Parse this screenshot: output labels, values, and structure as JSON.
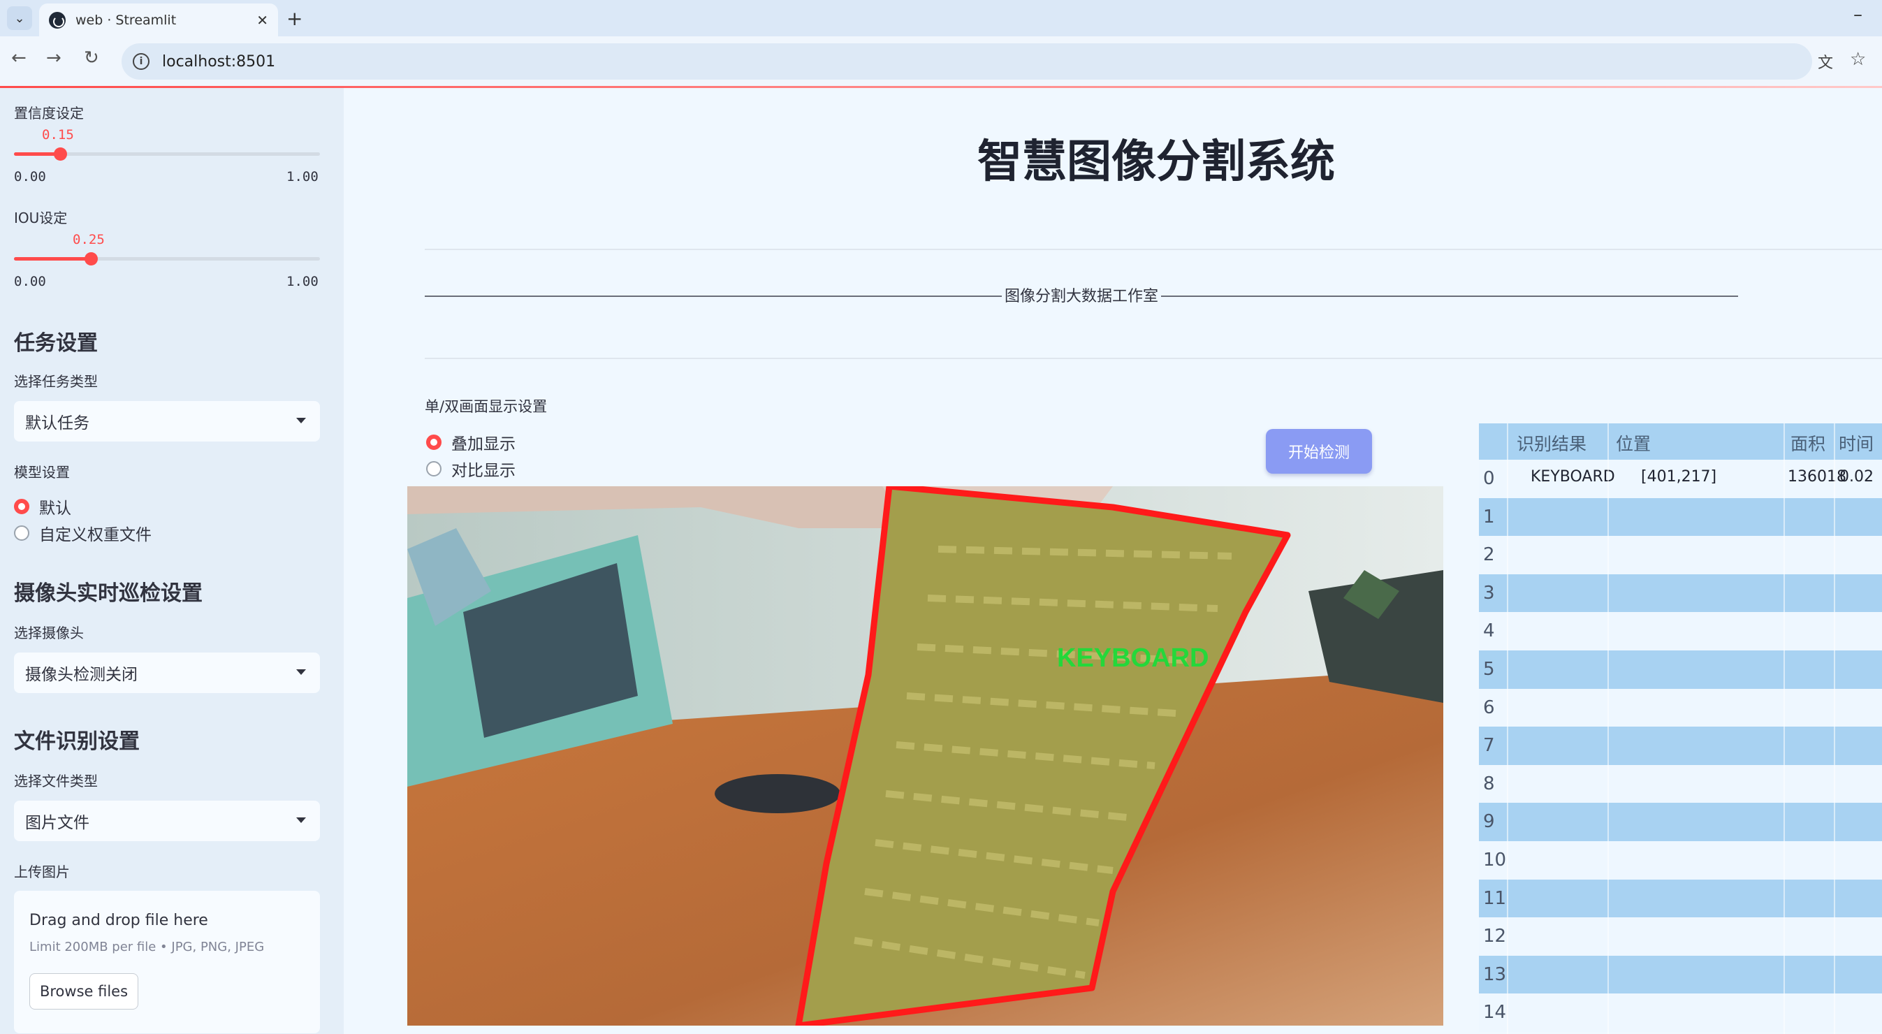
{
  "browser": {
    "tab_title": "web · Streamlit",
    "url": "localhost:8501"
  },
  "sidebar": {
    "confidence": {
      "label": "置信度设定",
      "value": "0.15",
      "min": "0.00",
      "max": "1.00",
      "fraction": 0.15
    },
    "iou": {
      "label": "IOU设定",
      "value": "0.25",
      "min": "0.00",
      "max": "1.00",
      "fraction": 0.25
    },
    "task_header": "任务设置",
    "task_type_label": "选择任务类型",
    "task_type_value": "默认任务",
    "model_label": "模型设置",
    "model_options": [
      "默认",
      "自定义权重文件"
    ],
    "camera_header": "摄像头实时巡检设置",
    "camera_label": "选择摄像头",
    "camera_value": "摄像头检测关闭",
    "file_header": "文件识别设置",
    "file_type_label": "选择文件类型",
    "file_type_value": "图片文件",
    "upload_label": "上传图片",
    "upload_title": "Drag and drop file here",
    "upload_limit": "Limit 200MB per file • JPG, PNG, JPEG",
    "browse_label": "Browse files"
  },
  "main": {
    "title": "智慧图像分割系统",
    "studio": "图像分割大数据工作室",
    "display_label": "单/双画面显示设置",
    "display_options": [
      "叠加显示",
      "对比显示"
    ],
    "start_button": "开始检测",
    "detection_label": "KEYBOARD"
  },
  "results": {
    "columns": [
      "识别结果",
      "位置",
      "面积",
      "时间"
    ],
    "rows": [
      {
        "idx": "0",
        "label": "KEYBOARD",
        "pos": "[401,217]",
        "area": "136018",
        "time": "0.02"
      },
      {
        "idx": "1"
      },
      {
        "idx": "2"
      },
      {
        "idx": "3"
      },
      {
        "idx": "4"
      },
      {
        "idx": "5"
      },
      {
        "idx": "6"
      },
      {
        "idx": "7"
      },
      {
        "idx": "8"
      },
      {
        "idx": "9"
      },
      {
        "idx": "10"
      },
      {
        "idx": "11"
      },
      {
        "idx": "12"
      },
      {
        "idx": "13"
      },
      {
        "idx": "14"
      }
    ]
  },
  "colors": {
    "accent": "#ff4b4b",
    "button": "#8a9bf3",
    "table_row": "#a8d2f2"
  }
}
